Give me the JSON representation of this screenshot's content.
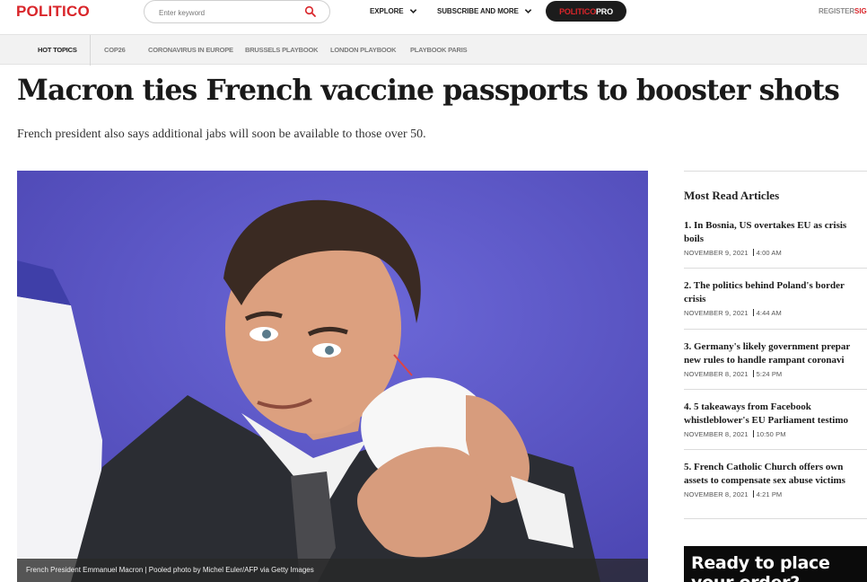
{
  "header": {
    "logo": "POLITICO",
    "search_placeholder": "Enter keyword",
    "explore_label": "EXPLORE",
    "subscribe_label": "SUBSCRIBE AND MORE",
    "pro_part1": "POLITICO",
    "pro_part2": "PRO",
    "register_label": "REGISTER",
    "signin_label": "SIGN"
  },
  "topics": {
    "hot": "HOT TOPICS",
    "items": [
      "COP26",
      "CORONAVIRUS IN EUROPE",
      "BRUSSELS PLAYBOOK",
      "LONDON PLAYBOOK",
      "PLAYBOOK PARIS"
    ]
  },
  "article": {
    "headline": "Macron ties French vaccine passports to booster shots",
    "dek": "French president also says additional jabs will soon be available to those over 50.",
    "caption": "French President Emmanuel Macron | Pooled photo by Michel Euler/AFP via Getty Images"
  },
  "sidebar": {
    "heading": "Most Read Articles",
    "items": [
      {
        "line1": "1. In Bosnia, US overtakes EU as crisis",
        "line2": "boils",
        "date": "NOVEMBER 9, 2021",
        "time": "4:00 AM"
      },
      {
        "line1": "2. The politics behind Poland's border",
        "line2": "crisis",
        "date": "NOVEMBER 9, 2021",
        "time": "4:44 AM"
      },
      {
        "line1": "3. Germany's likely government prepar",
        "line2": "new rules to handle rampant coronavi",
        "date": "NOVEMBER 8, 2021",
        "time": "5:24 PM"
      },
      {
        "line1": "4. 5 takeaways from Facebook",
        "line2": "whistleblower's EU Parliament testimo",
        "date": "NOVEMBER 8, 2021",
        "time": "10:50 PM"
      },
      {
        "line1": "5. French Catholic Church offers own",
        "line2": "assets to compensate sex abuse victims",
        "date": "NOVEMBER 8, 2021",
        "time": "4:21 PM"
      }
    ],
    "ad_line1": "Ready to place",
    "ad_line2": "your order?"
  },
  "colors": {
    "brand_red": "#d9252a",
    "pill_bg": "#1c1c1c",
    "photo_bg": "#5b55c6"
  },
  "icons": {
    "search": "search-icon",
    "chevron": "chevron-down-icon"
  }
}
